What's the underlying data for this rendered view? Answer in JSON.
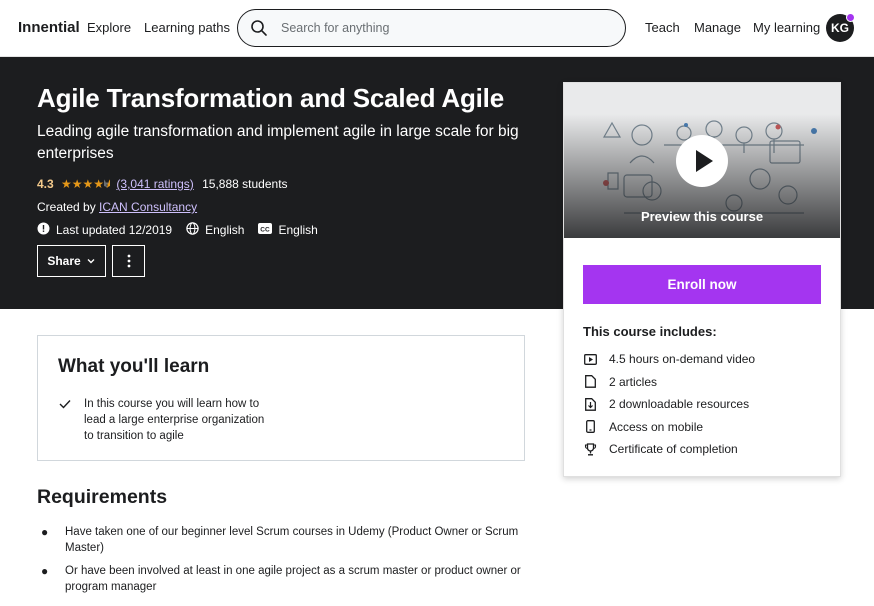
{
  "nav": {
    "brand": "Innential",
    "explore": "Explore",
    "learning_paths": "Learning paths",
    "search_placeholder": "Search for anything",
    "teach": "Teach",
    "manage": "Manage",
    "my_learning": "My learning",
    "avatar_initials": "KG"
  },
  "course": {
    "title": "Agile Transformation and Scaled Agile",
    "subtitle": "Leading agile transformation and implement agile in large scale for big enterprises",
    "rating": "4.3",
    "rating_stars": 4.3,
    "ratings_count": "(3,041 ratings)",
    "students": "15,888 students",
    "created_by_label": "Created by",
    "author": "ICAN Consultancy",
    "last_updated": "Last updated 12/2019",
    "language": "English",
    "captions": "English",
    "share_label": "Share"
  },
  "sidebar": {
    "preview_label": "Preview this course",
    "enroll_label": "Enroll now",
    "includes_title": "This course includes:",
    "includes": [
      {
        "icon": "video-icon",
        "text": "4.5 hours on-demand video"
      },
      {
        "icon": "file-icon",
        "text": "2 articles"
      },
      {
        "icon": "download-icon",
        "text": "2 downloadable resources"
      },
      {
        "icon": "mobile-icon",
        "text": "Access on mobile"
      },
      {
        "icon": "trophy-icon",
        "text": "Certificate of completion"
      }
    ]
  },
  "learn": {
    "title": "What you'll learn",
    "items": [
      "In this course you will learn how to lead a large enterprise organization to transition to agile"
    ]
  },
  "requirements": {
    "title": "Requirements",
    "items": [
      "Have taken one of our beginner level Scrum courses in Udemy (Product Owner or Scrum Master)",
      "Or have been involved at least in one agile project as a scrum master or product owner or program manager"
    ]
  },
  "colors": {
    "hero_bg": "#1c1d1f",
    "accent": "#a435f0",
    "star": "#e59819",
    "link_on_dark": "#cec0fc"
  }
}
